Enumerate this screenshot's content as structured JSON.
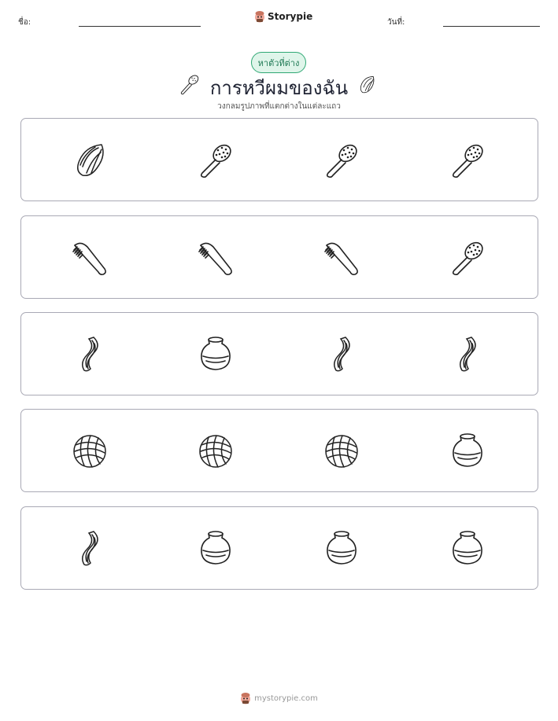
{
  "header": {
    "name_label": "ชื่อ:",
    "date_label": "วันที่:",
    "brand": "Storypie"
  },
  "badge": "หาตัวที่ต่าง",
  "title": "การหวีผมของฉัน",
  "subtitle": "วงกลมรูปภาพที่แตกต่างในแต่ละแถว",
  "rows": [
    {
      "items": [
        "hair-lock-icon",
        "hairbrush-icon",
        "hairbrush-icon",
        "hairbrush-icon"
      ]
    },
    {
      "items": [
        "comb-icon",
        "comb-icon",
        "comb-icon",
        "hairbrush-icon"
      ]
    },
    {
      "items": [
        "hair-strand-icon",
        "jar-icon",
        "hair-strand-icon",
        "hair-strand-icon"
      ]
    },
    {
      "items": [
        "yarn-ball-icon",
        "yarn-ball-icon",
        "yarn-ball-icon",
        "jar-icon"
      ]
    },
    {
      "items": [
        "hair-strand-icon",
        "jar-icon",
        "jar-icon",
        "jar-icon"
      ]
    }
  ],
  "footer": {
    "url": "mystorypie.com"
  }
}
